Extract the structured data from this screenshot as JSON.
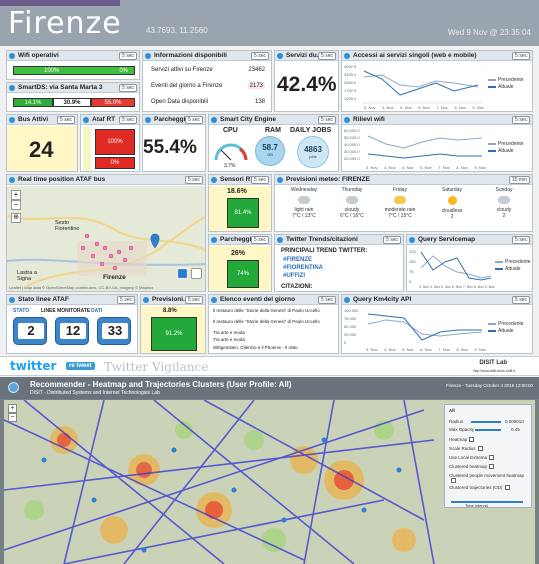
{
  "header": {
    "title": "Firenze",
    "coords": "43.7693, 11.2560",
    "datetime": "Wed 9 Nov @ 23:35:04"
  },
  "wifi": {
    "title": "Wifi operativi",
    "badge": "5 sec",
    "bar_left": "100%",
    "bar_right": "0%",
    "fill_pct": 0.85
  },
  "smartds": {
    "title": "SmartDS: via Santa Marta 3",
    "badge": "5 sec",
    "seg1": "14.1%",
    "seg2": "30.9%",
    "seg3": "55.0%"
  },
  "info": {
    "title": "Informazioni disponibili",
    "badge": "5 sec",
    "rows": [
      {
        "label": "Servizi attivi su Firenze",
        "value": "23462"
      },
      {
        "label": "Eventi del giorno a Firenze",
        "value": "2173"
      },
      {
        "label": "Open Data disponibili",
        "value": "138"
      }
    ]
  },
  "servizi": {
    "title": "Servizi du...",
    "badge": "5 sec",
    "value": "42.4%"
  },
  "accessi": {
    "title": "Accessi ai servizi singoli (web e mobile)",
    "badge": "5 sec",
    "yticks": [
      "4092.5",
      "3325.0",
      "2560.0",
      "1792.5",
      "1025.0"
    ],
    "xticks": [
      "3. Nov",
      "4. Nov",
      "5. Nov",
      "6. Nov",
      "7. Nov",
      "8. Nov",
      "9. Nov"
    ],
    "legend": [
      "Precedente",
      "Attuale"
    ],
    "colors": [
      "#8fa8c6",
      "#2f6fb3"
    ]
  },
  "bus": {
    "title": "Bus Attivi",
    "badge": "5 sec",
    "value": "24"
  },
  "atafrt": {
    "title": "Ataf RT",
    "badge": "5 sec",
    "top": "100%",
    "bottom": "0%"
  },
  "parcheggi1": {
    "title": "Parcheggi...",
    "badge": "5 sec",
    "value": "55.4%"
  },
  "engine": {
    "title": "Smart City Engine",
    "badge": "5 sec",
    "cpu_label": "CPU",
    "cpu_value": "3.7%",
    "ram_label": "RAM",
    "ram_value": "58.7",
    "ram_unit": "GB",
    "jobs_label": "DAILY JOBS",
    "jobs_value": "4863",
    "jobs_unit": "jobs"
  },
  "rilievi": {
    "title": "Rilievi wifi",
    "badge": "5 sec",
    "yticks": [
      "60,000.0",
      "50,000.0",
      "40,000.0",
      "30,000.0",
      "20,000.0"
    ],
    "xticks": [
      "3. Nov",
      "4. Nov",
      "5. Nov",
      "6. Nov",
      "7. Nov",
      "8. Nov",
      "9. Nov"
    ],
    "legend": [
      "Precedente",
      "Attuale"
    ]
  },
  "realtime": {
    "title": "Real time position ATAF bus",
    "badge": "5 sec",
    "places": [
      "Sesto Fiorentino",
      "Lastra a Signa",
      "Firenze"
    ],
    "attribution": "Leaflet | Map data © OpenStreetMap contributors, CC-BY-SA, Imagery © Mapbox"
  },
  "sensori": {
    "title": "Sensori RT",
    "badge": "5 sec",
    "value": "18.6%",
    "bar": "81.4%"
  },
  "meteo": {
    "title": "Previsioni meteo: FIRENZE",
    "badge": "15 min",
    "days": [
      {
        "day": "Wednesday",
        "desc": "light rain",
        "temp": "7°C / 13°C",
        "icon": "rain-icon"
      },
      {
        "day": "Thursday",
        "desc": "cloudy",
        "temp": "6°C / 16°C",
        "icon": "cloud-icon"
      },
      {
        "day": "Friday",
        "desc": "moderate rain",
        "temp": "7°C / 15°C",
        "icon": "rain-sun-icon"
      },
      {
        "day": "Saturday",
        "desc": "cloudless",
        "temp": "2",
        "icon": "sun-icon"
      },
      {
        "day": "Sunday",
        "desc": "cloudy",
        "temp": "2",
        "icon": "cloud-icon"
      }
    ]
  },
  "parcheggi2": {
    "title": "Parcheggi...",
    "badge": "5 sec",
    "value": "26%",
    "bar": "74%"
  },
  "twitter": {
    "title": "Twitter Trends/citazioni",
    "badge": "5 sec",
    "heading": "PRINCIPALI TREND TWITTER:",
    "trends": [
      "#FIRENZE",
      "#FIORENTINA",
      "#UFFIZI"
    ],
    "footer": "CITAZIONI:"
  },
  "query_sm": {
    "title": "Query Servicemap",
    "badge": "5 sec",
    "yticks": [
      "225",
      "150",
      "75",
      "0"
    ],
    "xticks": [
      "3. Nov",
      "4. Nov",
      "5. Nov",
      "6. Nov",
      "7. Nov",
      "8. Nov",
      "9. Nov"
    ],
    "legend": [
      "Precedente",
      "Attuale"
    ]
  },
  "stato": {
    "title": "Stato linee ATAF",
    "badge": "5 sec",
    "labels": [
      "STATO",
      "LINEE MONITORATE",
      "DATI"
    ],
    "values": [
      "2",
      "12",
      "33"
    ]
  },
  "previsioni": {
    "title": "Previsioni...",
    "badge": "5 sec",
    "value": "8.8%",
    "bar": "91.2%"
  },
  "eventi": {
    "title": "Elenco eventi del giorno",
    "badge": "5 sec",
    "items": [
      "Il restauro delle \"Storie della Genesi\" di Paolo Uccello",
      "Il restauro delle \"Storie della Genesi\" di Paolo Uccello",
      "Tra arte e moda",
      "Tra arte e moda",
      "Wittgenstein, Gilenzio e il Phoenix - Il ratto"
    ]
  },
  "query_km": {
    "title": "Query Km4city API",
    "badge": "5 sec",
    "yticks": [
      "100 000",
      "75 000",
      "50 000",
      "25 000",
      "0"
    ],
    "xticks": [
      "3. Nov",
      "4. Nov",
      "5. Nov",
      "6. Nov",
      "7. Nov",
      "8. Nov",
      "9. Nov"
    ],
    "legend": [
      "Precedente",
      "Attuale"
    ]
  },
  "twitterbar": {
    "brand": "twitter",
    "retweet": "re tweet",
    "vigilance": "Twitter Vigilance",
    "disit": "DISIT Lab",
    "url": "http://www.disit.dinfo.unifi.it"
  },
  "recommender": {
    "title": "Recommender - Heatmap and Trajectories Clusters (User Profile: All)",
    "subtitle": "DISIT - Distributed Systems and Internet Technologies Lab",
    "date": "Firenze - Tuesday October 4 2016 13:00:00",
    "controls": {
      "profile": "All",
      "radius": "Radius",
      "radius_val": "0.000010",
      "max_opacity": "Max Opacity",
      "opacity_val": "0.45",
      "heatmap": "Heatmap",
      "scale_radius": "Scale Radius",
      "use_local": "Use Local Extrema",
      "clustered": "Clustered heatmap",
      "clustered_people": "Clustered people movement heatmap",
      "clustered_traj": "Clustered trajectories (OD)",
      "range": "Time interval"
    }
  }
}
